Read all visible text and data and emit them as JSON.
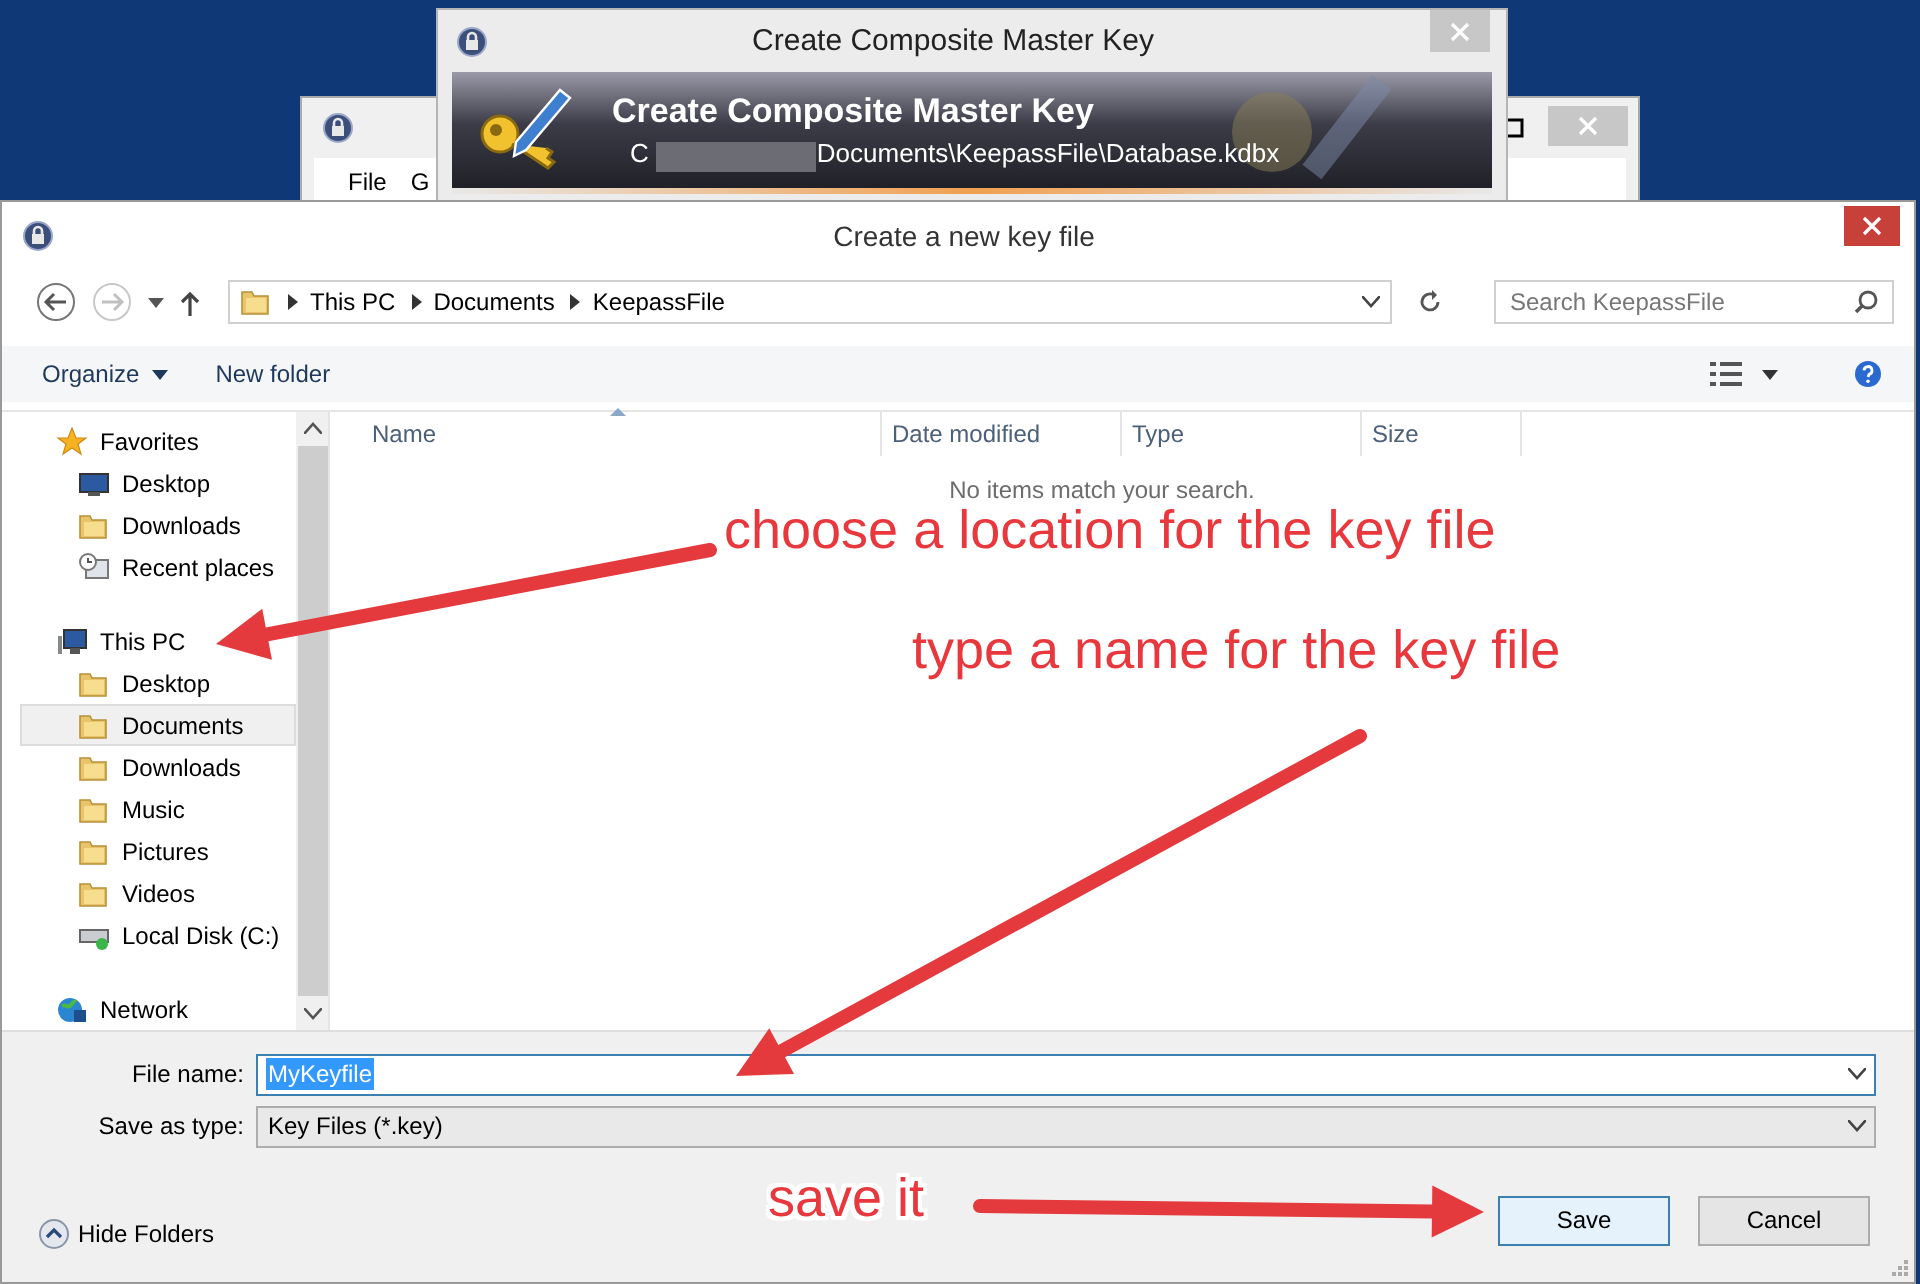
{
  "keepass_window": {
    "menu": [
      "File",
      "G"
    ]
  },
  "composite_dialog": {
    "title": "Create Composite Master Key",
    "banner_title": "Create Composite Master Key",
    "banner_path_start": "C",
    "banner_path_end": "Documents\\KeepassFile\\Database.kdbx"
  },
  "dialog": {
    "title": "Create a new key file",
    "breadcrumb": [
      "This PC",
      "Documents",
      "KeepassFile"
    ],
    "search": {
      "placeholder": "Search KeepassFile"
    },
    "toolbar": [
      {
        "label": "Organize",
        "dropdown": true
      },
      {
        "label": "New folder",
        "dropdown": false
      }
    ],
    "sidebar": [
      {
        "label": "Favorites",
        "kind": "star",
        "selected": false,
        "children": [
          {
            "label": "Desktop",
            "kind": "monitor",
            "selected": false
          },
          {
            "label": "Downloads",
            "kind": "folder",
            "selected": false
          },
          {
            "label": "Recent places",
            "kind": "recent",
            "selected": false
          }
        ]
      },
      {
        "label": "This PC",
        "kind": "computer",
        "selected": false,
        "children": [
          {
            "label": "Desktop",
            "kind": "folder",
            "selected": false
          },
          {
            "label": "Documents",
            "kind": "folder",
            "selected": true
          },
          {
            "label": "Downloads",
            "kind": "folder",
            "selected": false
          },
          {
            "label": "Music",
            "kind": "folder",
            "selected": false
          },
          {
            "label": "Pictures",
            "kind": "folder",
            "selected": false
          },
          {
            "label": "Videos",
            "kind": "folder",
            "selected": false
          },
          {
            "label": "Local Disk (C:)",
            "kind": "disk",
            "selected": false
          }
        ]
      },
      {
        "label": "Network",
        "kind": "globe",
        "selected": false
      }
    ],
    "columns": [
      "Name",
      "Date modified",
      "Type",
      "Size"
    ],
    "empty_message": "No items match your search.",
    "file_name": {
      "label": "File name:",
      "value": "MyKeyfile",
      "text_selected": true
    },
    "save_as_type": {
      "label": "Save as type:",
      "value": "Key Files (*.key)"
    },
    "hide_folders": "Hide Folders",
    "buttons": [
      {
        "label": "Save",
        "default": true
      },
      {
        "label": "Cancel",
        "default": false
      }
    ]
  },
  "annotations": [
    "choose a location for the key file",
    "type a name for the key file",
    "save it"
  ]
}
